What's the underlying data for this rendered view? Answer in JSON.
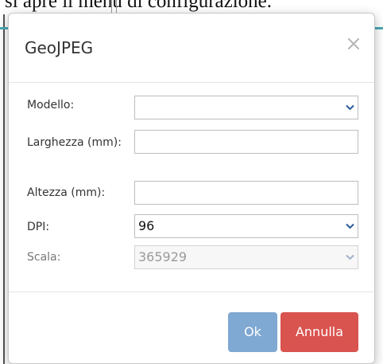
{
  "background": {
    "heading_fragment": "si apre il menù di configurazione."
  },
  "dialog": {
    "title": "GeoJPEG",
    "close_icon": "close-icon",
    "fields": {
      "model": {
        "label": "Modello:",
        "value": ""
      },
      "width": {
        "label": "Larghezza (mm):",
        "value": ""
      },
      "height": {
        "label": "Altezza (mm):",
        "value": ""
      },
      "dpi": {
        "label": "DPI:",
        "value": "96"
      },
      "scale": {
        "label": "Scala:",
        "value": "365929"
      }
    },
    "buttons": {
      "ok": "Ok",
      "cancel": "Annulla"
    },
    "colors": {
      "ok_button": "#7fa8d2",
      "cancel_button": "#d9534f",
      "caret": "#2a5b9a"
    }
  }
}
